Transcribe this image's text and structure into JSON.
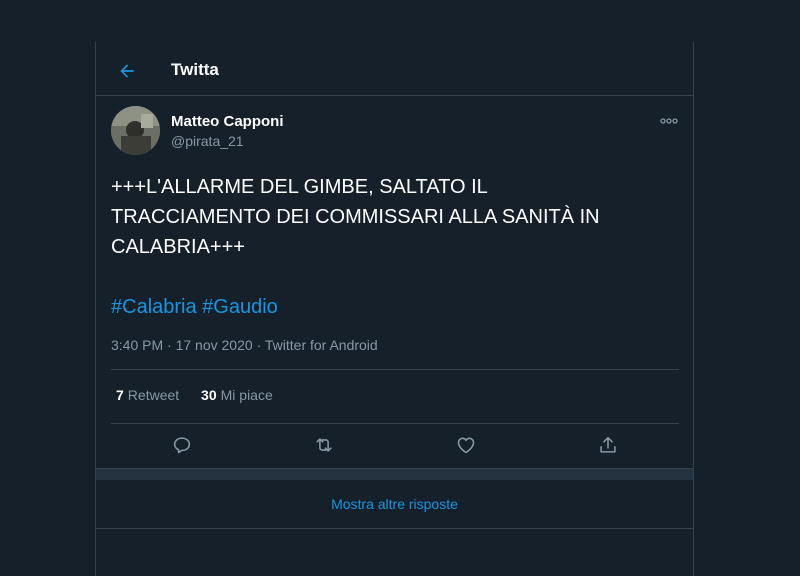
{
  "colors": {
    "background": "#15202b",
    "border": "#38444d",
    "accent": "#1b95e0",
    "secondary_text": "#8899a6",
    "primary_text": "#ffffff"
  },
  "header": {
    "back_icon": "arrow-left-icon",
    "title": "Twitta"
  },
  "tweet": {
    "author": {
      "name": "Matteo Capponi",
      "handle": "@pirata_21"
    },
    "more_icon": "more-dots-icon",
    "text_lines": [
      "+++L'ALLARME DEL GIMBE, SALTATO IL",
      "TRACCIAMENTO DEI COMMISSARI ALLA SANITÀ IN",
      "CALABRIA+++"
    ],
    "hashtags": [
      "#Calabria",
      "#Gaudio"
    ],
    "time": "3:40 PM",
    "separator": "·",
    "date": "17 nov 2020",
    "source": "Twitter for Android",
    "stats": {
      "retweets_count": "7",
      "retweets_label": "Retweet",
      "likes_count": "30",
      "likes_label": "Mi piace"
    },
    "actions": [
      "reply-icon",
      "retweet-icon",
      "like-icon",
      "share-icon"
    ]
  },
  "footer": {
    "show_more": "Mostra altre risposte"
  }
}
